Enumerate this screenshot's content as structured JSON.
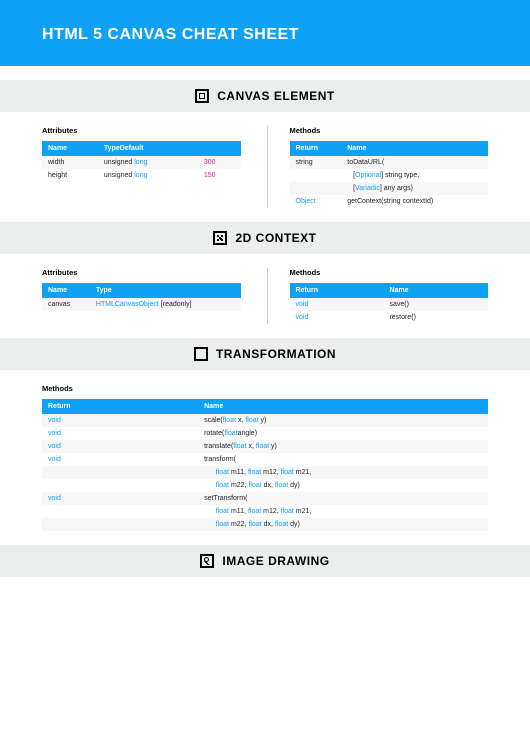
{
  "title": "HTML 5 CANVAS CHEAT SHEET",
  "sections": {
    "canvas_element": "CANVAS ELEMENT",
    "context2d": "2D CONTEXT",
    "transformation": "TRANSFORMATION",
    "image_drawing": "IMAGE DRAWING"
  },
  "labels": {
    "attributes": "Attributes",
    "methods": "Methods",
    "name": "Name",
    "type_default": "TypeDefault",
    "type": "Type",
    "return": "Return"
  },
  "canvas_attrs": {
    "r1": {
      "name": "width",
      "pre": "unsigned ",
      "long": "long",
      "def": "300"
    },
    "r2": {
      "name": "height",
      "pre": "unsigned ",
      "long": "long",
      "def": "150"
    }
  },
  "canvas_methods": {
    "r1": {
      "ret": "string",
      "name": "toDataURL("
    },
    "r2": {
      "opt": "Optional",
      "in": "[",
      "aft": "] string type,"
    },
    "r3": {
      "var": "Variadic",
      "in": "[",
      "aft": "] any args)"
    },
    "r4": {
      "ret": "Object",
      "name": "getContext(string contextId)"
    }
  },
  "ctx_attrs": {
    "r1": {
      "name": "canvas",
      "type": "HTMLCanvasObject",
      "suf": " [readonly]"
    }
  },
  "ctx_methods": {
    "r1": {
      "ret": "void",
      "name": "save()"
    },
    "r2": {
      "ret": "void",
      "name": "restore()"
    }
  },
  "transf": {
    "r1": {
      "ret": "void",
      "n": "scale(",
      "a": "float",
      "s1": " x, ",
      "b": "float",
      "s2": " y)"
    },
    "r2": {
      "ret": "void",
      "n": "rotate(",
      "a": "float",
      "s1": "angle)"
    },
    "r3": {
      "ret": "void",
      "n": "translate(",
      "a": "float",
      "s1": " x, ",
      "b": "float",
      "s2": " y)"
    },
    "r4": {
      "ret": "void",
      "n": "transform("
    },
    "r5": {
      "a": "float",
      "s1": " m11, ",
      "b": "float",
      "s2": " m12, ",
      "c": "float",
      "s3": " m21,"
    },
    "r6": {
      "a": "float",
      "s1": " m22, ",
      "b": "float",
      "s2": " dx, ",
      "c": "float",
      "s3": " dy)"
    },
    "r7": {
      "ret": "void",
      "n": "setTransform("
    },
    "r8": {
      "a": "float",
      "s1": " m11, ",
      "b": "float",
      "s2": " m12, ",
      "c": "float",
      "s3": " m21,"
    },
    "r9": {
      "a": "float",
      "s1": " m22, ",
      "b": "float",
      "s2": " dx, ",
      "c": "float",
      "s3": " dy)"
    }
  }
}
